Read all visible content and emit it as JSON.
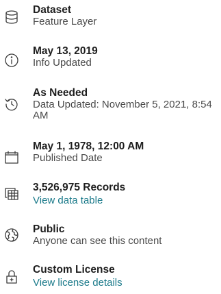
{
  "items": [
    {
      "icon": "database-icon",
      "title": "Dataset",
      "subtitle": "Feature Layer"
    },
    {
      "icon": "info-icon",
      "title": "May 13, 2019",
      "subtitle": "Info Updated"
    },
    {
      "icon": "history-icon",
      "title": "As Needed",
      "subtitle": "Data Updated: November 5, 2021, 8:54 AM"
    },
    {
      "icon": "calendar-icon",
      "title": "May 1, 1978, 12:00 AM",
      "subtitle": "Published Date"
    },
    {
      "icon": "table-icon",
      "title": "3,526,975 Records",
      "link": "View data table"
    },
    {
      "icon": "globe-icon",
      "title": "Public",
      "subtitle": "Anyone can see this content"
    },
    {
      "icon": "license-icon",
      "title": "Custom License",
      "link": "View license details"
    }
  ],
  "colors": {
    "link": "#1b7a8a",
    "text": "#2b2b2b"
  }
}
